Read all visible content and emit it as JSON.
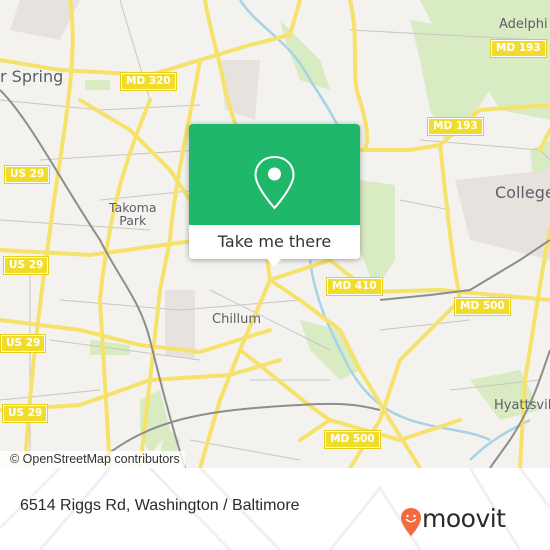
{
  "map": {
    "attribution": "© OpenStreetMap contributors",
    "place_labels": [
      {
        "id": "silver-spring",
        "text": "r Spring"
      },
      {
        "id": "adelphi",
        "text": "Adelphi"
      },
      {
        "id": "takoma-park-line1",
        "text": "Takoma"
      },
      {
        "id": "takoma-park-line2",
        "text": "Park"
      },
      {
        "id": "college-park",
        "text": "College"
      },
      {
        "id": "chillum",
        "text": "Chillum"
      },
      {
        "id": "hyattsville",
        "text": "Hyattsvil"
      }
    ],
    "route_shields": [
      {
        "id": "md320",
        "text": "MD 320"
      },
      {
        "id": "md193-top",
        "text": "MD 193"
      },
      {
        "id": "md193-mid",
        "text": "MD 193"
      },
      {
        "id": "us29-1",
        "text": "US 29"
      },
      {
        "id": "us29-2",
        "text": "US 29"
      },
      {
        "id": "us29-3",
        "text": "US 29"
      },
      {
        "id": "us29-4",
        "text": "US 29"
      },
      {
        "id": "md410",
        "text": "MD 410"
      },
      {
        "id": "md500-east",
        "text": "MD 500"
      },
      {
        "id": "md500-south",
        "text": "MD 500"
      }
    ],
    "colors": {
      "background": "#f3f2ee",
      "major_road": "#f6e26b",
      "park": "#d9ebc3",
      "water": "#a8d2e6",
      "rail": "#8d8d8d",
      "shield": "#f2dc2b"
    }
  },
  "popup": {
    "icon": "map-pin-icon",
    "button_label": "Take me there",
    "color": "#1fb86b"
  },
  "footer": {
    "address": "6514 Riggs Rd, Washington / Baltimore",
    "brand": "moovit",
    "brand_color": "#f26a3d"
  }
}
